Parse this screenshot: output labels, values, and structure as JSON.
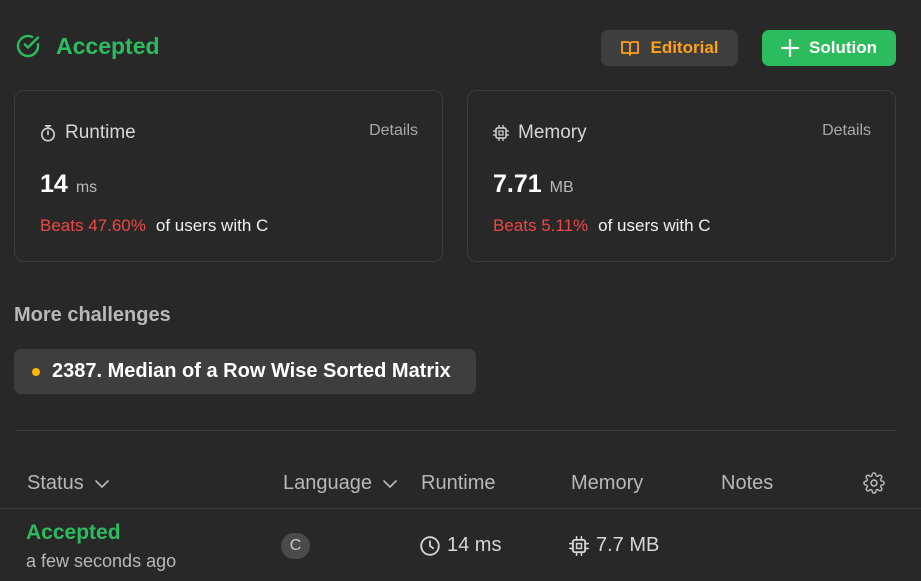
{
  "header": {
    "status": "Accepted",
    "editorial_label": "Editorial",
    "solution_label": "Solution"
  },
  "runtime_card": {
    "title": "Runtime",
    "details": "Details",
    "value": "14",
    "unit": "ms",
    "beats": "Beats 47.60%",
    "suffix": "of users with C"
  },
  "memory_card": {
    "title": "Memory",
    "details": "Details",
    "value": "7.71",
    "unit": "MB",
    "beats": "Beats 5.11%",
    "suffix": "of users with C"
  },
  "more_challenges": {
    "title": "More challenges",
    "items": [
      {
        "label": "2387. Median of a Row Wise Sorted Matrix",
        "difficulty_color": "#ffb800"
      }
    ]
  },
  "table": {
    "headers": {
      "status": "Status",
      "language": "Language",
      "runtime": "Runtime",
      "memory": "Memory",
      "notes": "Notes"
    },
    "rows": [
      {
        "status": "Accepted",
        "time": "a few seconds ago",
        "language": "C",
        "runtime": "14 ms",
        "memory": "7.7 MB"
      }
    ]
  },
  "colors": {
    "accepted": "#2cbb5d",
    "editorial": "#ffa116",
    "beats": "#ef4743",
    "background": "#282828"
  },
  "icons": [
    "check-circle-icon",
    "book-icon",
    "plus-icon",
    "stopwatch-icon",
    "cpu-icon",
    "chevron-down-icon",
    "clock-icon",
    "gear-icon"
  ]
}
